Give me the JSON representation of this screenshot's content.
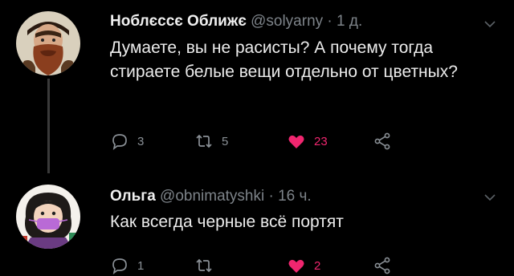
{
  "tweets": [
    {
      "author": "Ноблєссє Оближє",
      "handle": "@solyarny",
      "separator": "·",
      "time": "1 д.",
      "text": "Думаете, вы не расисты? А почему тогда стираете белые вещи отдельно от цветных?",
      "replies": "3",
      "retweets": "5",
      "likes": "23",
      "avatar_icon": "bearded-man-avatar"
    },
    {
      "author": "Ольга",
      "handle": "@obnimatyshki",
      "separator": "·",
      "time": "16 ч.",
      "text": "Как всегда черные всё портят",
      "replies": "1",
      "retweets": "",
      "likes": "2",
      "avatar_icon": "cartoon-girl-avatar"
    }
  ],
  "colors": {
    "background": "#000000",
    "text": "#e7e9ea",
    "muted": "#7d8389",
    "like": "#f0266f",
    "icon": "#8a9096"
  }
}
